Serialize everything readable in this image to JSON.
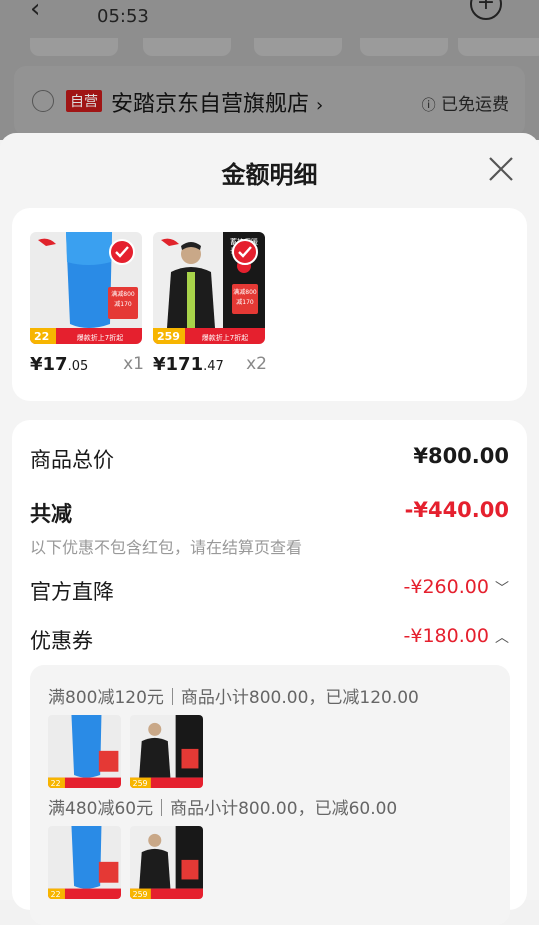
{
  "status": {
    "time": "05:53"
  },
  "store": {
    "tag": "自营",
    "name": "安踏京东自营旗舰店",
    "chevron": "›",
    "shipping": "已免运费"
  },
  "sheet": {
    "title": "金额明细"
  },
  "products": [
    {
      "price_main": "¥17",
      "price_dec": ".05",
      "qty": "x1",
      "badge_left": "22",
      "banner": "爆款折上7折起",
      "promo": "满800减170"
    },
    {
      "price_main": "¥171",
      "price_dec": ".47",
      "qty": "x2",
      "badge_left": "259",
      "banner": "爆款折上7折起",
      "promo": "满800减170"
    }
  ],
  "summary": {
    "total_label": "商品总价",
    "total_value": "¥800.00",
    "reduce_label": "共减",
    "reduce_value": "-¥440.00",
    "reduce_note": "以下优惠不包含红包，请在结算页查看",
    "direct_label": "官方直降",
    "direct_value": "-¥260.00",
    "coupon_label": "优惠券",
    "coupon_value": "-¥180.00"
  },
  "coupons": [
    {
      "text": "满800减120元｜商品小计800.00，已减120.00"
    },
    {
      "text": "满480减60元｜商品小计800.00，已减60.00"
    }
  ],
  "colors": {
    "accent": "#e5202e",
    "card": "#ffffff",
    "sheet": "#f4f4f4"
  }
}
